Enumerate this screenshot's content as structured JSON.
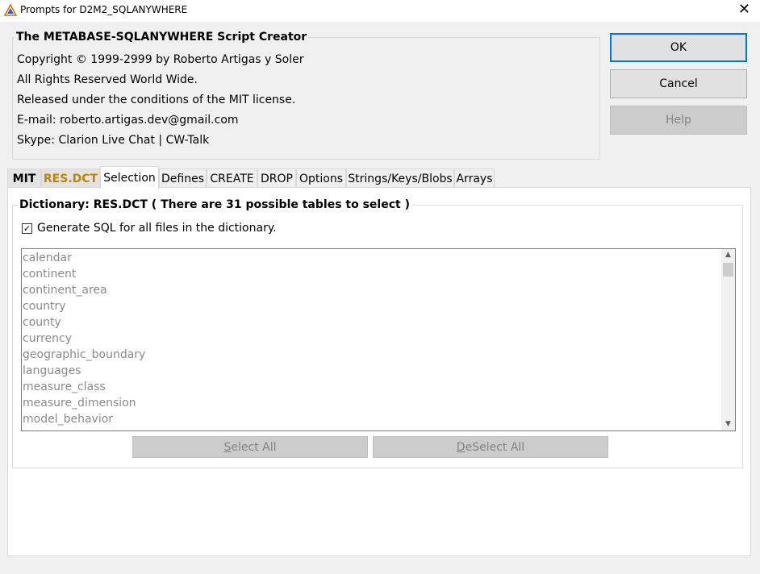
{
  "window": {
    "title": "Prompts for D2M2_SQLANYWHERE",
    "close_label": "✕"
  },
  "header": {
    "title": "The METABASE-SQLANYWHERE Script Creator",
    "lines": [
      "Copyright © 1999-2999 by Roberto Artigas y Soler",
      "All Rights Reserved World Wide.",
      "Released under the conditions of the MIT license.",
      "E-mail: roberto.artigas.dev@gmail.com",
      "Skype: Clarion Live Chat | CW-Talk"
    ]
  },
  "buttons": {
    "ok": "OK",
    "cancel": "Cancel",
    "help": "Help"
  },
  "tabs": [
    "MIT",
    "RES.DCT",
    "Selection",
    "Defines",
    "CREATE",
    "DROP",
    "Options",
    "Strings/Keys/Blobs",
    "Arrays"
  ],
  "active_tab": "Selection",
  "selection": {
    "group_title": "Dictionary: RES.DCT ( There are 31 possible tables to select )",
    "checkbox_label": "Generate SQL for all files in the dictionary.",
    "checkbox_checked": true,
    "tables": [
      "calendar",
      "continent",
      "continent_area",
      "country",
      "county",
      "currency",
      "geographic_boundary",
      "languages",
      "measure_class",
      "measure_dimension",
      "model_behavior"
    ],
    "select_all_prefix": "S",
    "select_all_rest": "elect All",
    "deselect_all_prefix": "D",
    "deselect_all_rest": "eSelect All"
  },
  "colors": {
    "accent": "#0078d7",
    "res_tab": "#b8860b"
  }
}
